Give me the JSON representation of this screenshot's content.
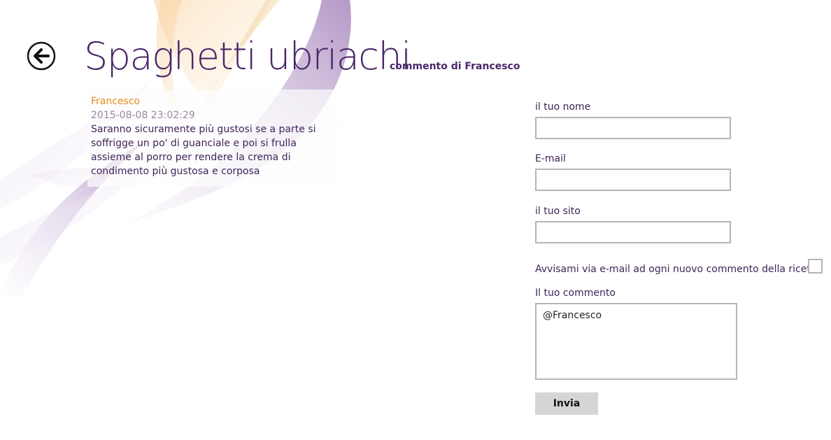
{
  "header": {
    "back_icon": "back-arrow-icon",
    "title": "Spaghetti ubriachi",
    "subtitle": "commento di Francesco"
  },
  "comment": {
    "author": "Francesco",
    "date": "2015-08-08 23:02:29",
    "text": "Saranno sicuramente più gustosi se a parte si soffrigge un po' di guanciale e poi si frulla assieme al porro per rendere la crema di condimento più gustosa e corposa"
  },
  "form": {
    "name_label": "il tuo nome",
    "name_value": "",
    "email_label": "E-mail",
    "email_value": "",
    "site_label": "il tuo sito",
    "site_value": "",
    "notify_label": "Avvisami via e-mail ad ogni nuovo commento della ricetta",
    "notify_checked": false,
    "comment_label": "Il tuo commento",
    "comment_value": "@Francesco",
    "submit_label": "Invia"
  },
  "colors": {
    "title": "#4b2668",
    "author": "#e88b1a",
    "date": "#9b84a8",
    "text": "#3f2458",
    "input_border": "#b5b5b5",
    "button_bg": "#d5d5d5"
  }
}
